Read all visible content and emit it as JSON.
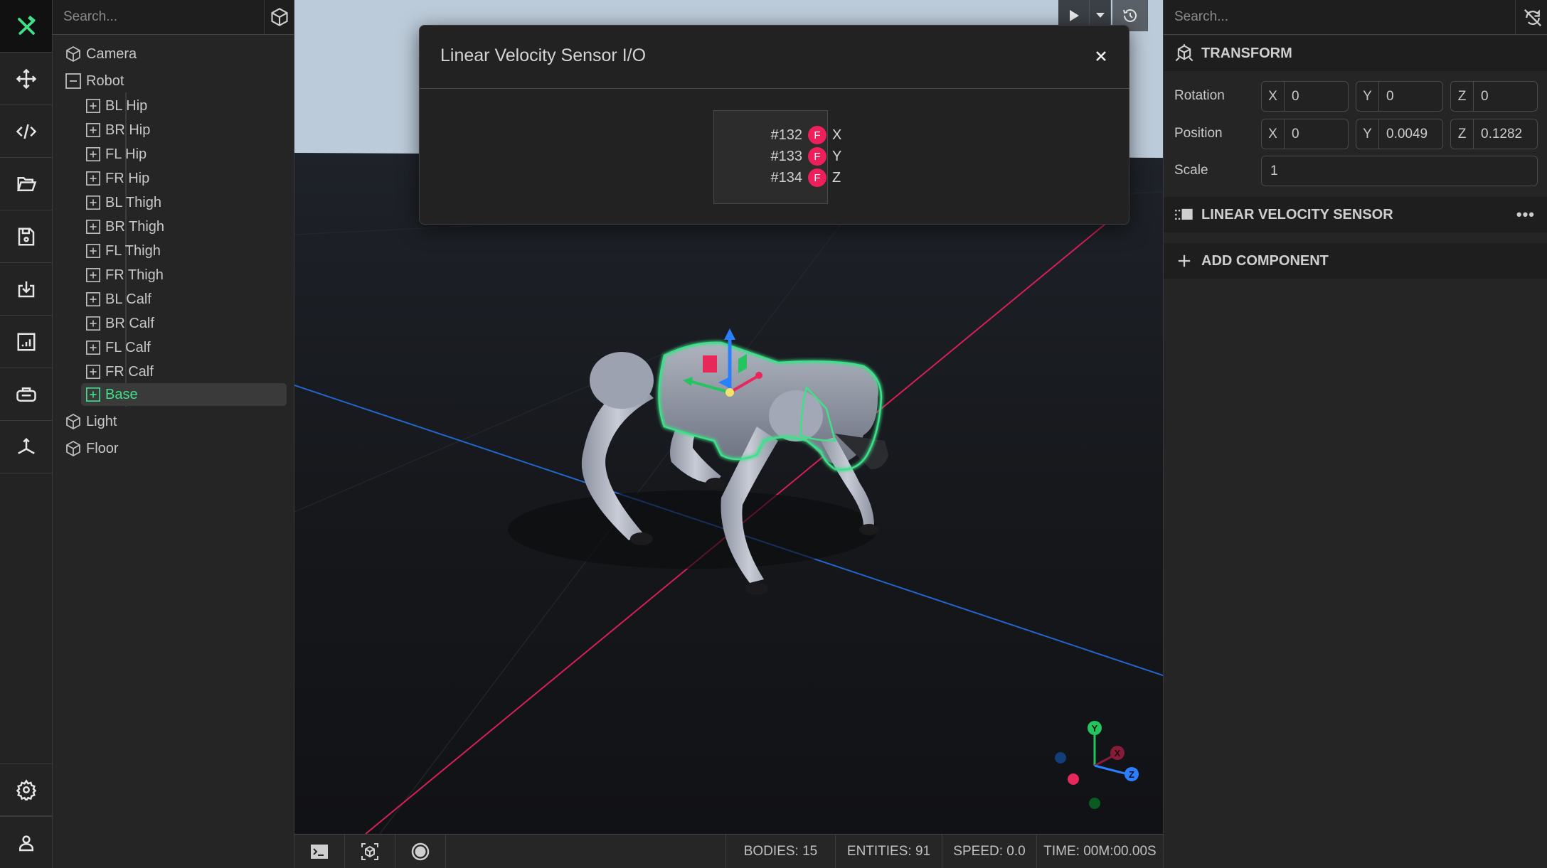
{
  "iconbar": {
    "items": [
      {
        "name": "tools-logo-icon",
        "active": true
      },
      {
        "name": "move-icon"
      },
      {
        "name": "code-icon"
      },
      {
        "name": "open-folder-icon"
      },
      {
        "name": "save-icon"
      },
      {
        "name": "import-icon"
      },
      {
        "name": "chart-icon"
      },
      {
        "name": "vr-headset-icon"
      },
      {
        "name": "axes-icon"
      }
    ],
    "bottom": [
      {
        "name": "settings-gear-icon"
      },
      {
        "name": "user-icon"
      }
    ],
    "accent": "#3ee089"
  },
  "tree": {
    "search_placeholder": "Search...",
    "nodes": [
      {
        "label": "Camera",
        "type": "object",
        "level": 0
      },
      {
        "label": "Robot",
        "type": "collapse",
        "level": 0
      },
      {
        "label": "BL Hip",
        "type": "expand",
        "level": 1
      },
      {
        "label": "BR Hip",
        "type": "expand",
        "level": 1
      },
      {
        "label": "FL Hip",
        "type": "expand",
        "level": 1
      },
      {
        "label": "FR Hip",
        "type": "expand",
        "level": 1
      },
      {
        "label": "BL Thigh",
        "type": "expand",
        "level": 1
      },
      {
        "label": "BR Thigh",
        "type": "expand",
        "level": 1
      },
      {
        "label": "FL Thigh",
        "type": "expand",
        "level": 1
      },
      {
        "label": "FR Thigh",
        "type": "expand",
        "level": 1
      },
      {
        "label": "BL Calf",
        "type": "expand",
        "level": 1
      },
      {
        "label": "BR Calf",
        "type": "expand",
        "level": 1
      },
      {
        "label": "FL Calf",
        "type": "expand",
        "level": 1
      },
      {
        "label": "FR Calf",
        "type": "expand",
        "level": 1
      },
      {
        "label": "Base",
        "type": "expand",
        "level": 1,
        "selected": true
      },
      {
        "label": "Light",
        "type": "object",
        "level": 0
      },
      {
        "label": "Floor",
        "type": "object",
        "level": 0
      }
    ]
  },
  "modal": {
    "title": "Linear Velocity Sensor I/O",
    "close_label": "×",
    "ports": [
      {
        "id": "#132",
        "pin": "F",
        "axis": "X"
      },
      {
        "id": "#133",
        "pin": "F",
        "axis": "Y"
      },
      {
        "id": "#134",
        "pin": "F",
        "axis": "Z"
      }
    ],
    "pin_color": "#ef1f5c"
  },
  "viewport": {
    "gizmo_axes": [
      "Y",
      "X",
      "Z"
    ],
    "colors": {
      "x": "#e8275a",
      "y": "#22c55e",
      "z": "#2a7fff",
      "selection": "#3ee089"
    }
  },
  "statusbar": {
    "buttons": [
      "terminal-icon",
      "focus-object-icon",
      "record-icon"
    ],
    "bodies": "BODIES: 15",
    "entities": "ENTITIES: 91",
    "speed": "SPEED: 0.0",
    "time": "TIME: 00M:00.00S"
  },
  "inspector": {
    "search_placeholder": "Search...",
    "transform": {
      "title": "TRANSFORM",
      "rotation_label": "Rotation",
      "rotation": {
        "x": "0",
        "y": "0",
        "z": "0"
      },
      "position_label": "Position",
      "position": {
        "x": "0",
        "y": "0.0049",
        "z": "0.1282"
      },
      "scale_label": "Scale",
      "scale": "1"
    },
    "component": {
      "title": "LINEAR VELOCITY SENSOR",
      "more": "•••"
    },
    "add_component": "ADD COMPONENT",
    "axis_labels": {
      "x": "X",
      "y": "Y",
      "z": "Z"
    }
  }
}
